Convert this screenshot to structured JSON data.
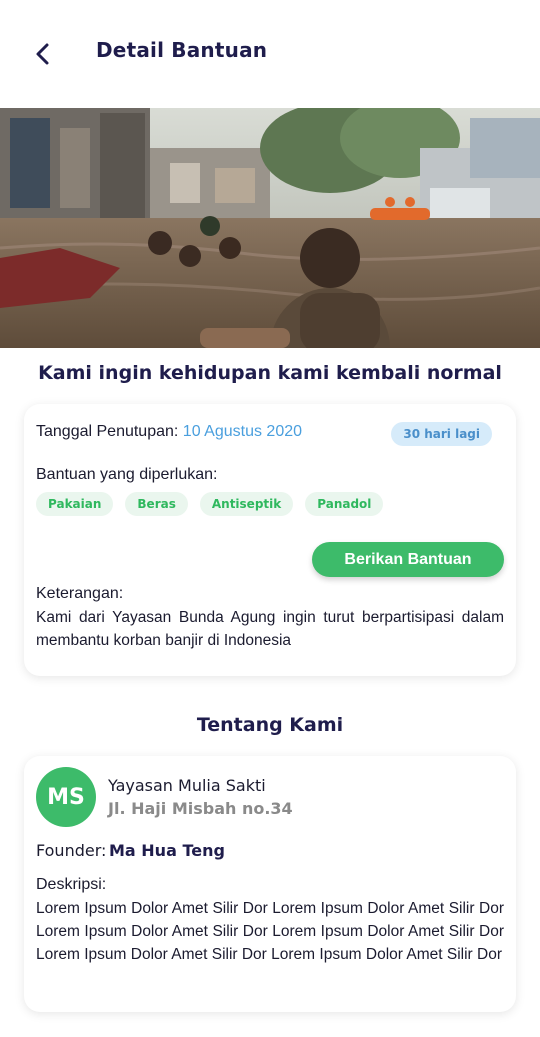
{
  "appbar": {
    "title": "Detail Bantuan"
  },
  "campaign": {
    "title": "Kami ingin kehidupan kami kembali normal",
    "closing_label": "Tanggal Penutupan:",
    "closing_date": "10 Agustus 2020",
    "days_left": "30 hari lagi",
    "needs_label": "Bantuan yang diperlukan:",
    "needs": [
      "Pakaian",
      "Beras",
      "Antiseptik",
      "Panadol"
    ],
    "give_button": "Berikan Bantuan",
    "notes_label": "Keterangan:",
    "notes_text": "Kami dari Yayasan Bunda Agung ingin turut berpartisipasi dalam membantu korban banjir di Indonesia"
  },
  "about": {
    "title": "Tentang Kami",
    "avatar_initials": "MS",
    "org_name": "Yayasan Mulia Sakti",
    "org_address": "Jl. Haji Misbah no.34",
    "founder_label": "Founder:",
    "founder_name": "Ma Hua Teng",
    "description_label": "Deskripsi:",
    "description_text": "Lorem Ipsum Dolor Amet Silir Dor Lorem Ipsum Dolor Amet Silir Dor Lorem Ipsum Dolor Amet Silir Dor Lorem Ipsum Dolor Amet Silir Dor Lorem Ipsum Dolor Amet Silir Dor Lorem Ipsum Dolor Amet Silir Dor"
  },
  "icons": {
    "back": "chevron-left-icon"
  },
  "colors": {
    "accent_green": "#3dbb6a",
    "accent_blue": "#4a9fde",
    "title_navy": "#1f1d4c"
  }
}
